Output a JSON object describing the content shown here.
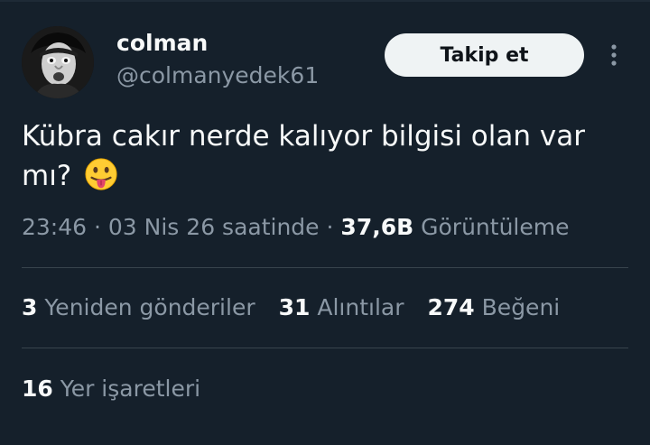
{
  "author": {
    "display_name": "colman",
    "handle": "@colmanyedek61",
    "avatar_icon": "profile-photo"
  },
  "follow_button": {
    "label": "Takip et"
  },
  "more_icon": "more-vertical-icon",
  "tweet": {
    "text": "Kübra cakır nerde kalıyor bilgisi olan var mı?",
    "emoji": "face-with-tongue-emoji"
  },
  "meta": {
    "time": "23:46",
    "date": "03 Nis 26 saatinde",
    "separator": "·",
    "views_count": "37,6B",
    "views_label": "Görüntüleme"
  },
  "stats": {
    "retweets": {
      "count": "3",
      "label": "Yeniden gönderiler"
    },
    "quotes": {
      "count": "31",
      "label": "Alıntılar"
    },
    "likes": {
      "count": "274",
      "label": "Beğeni"
    },
    "bookmarks": {
      "count": "16",
      "label": "Yer işaretleri"
    }
  },
  "colors": {
    "background": "#15202b",
    "text_primary": "#f7f9f9",
    "text_secondary": "#8b98a5",
    "divider": "#38444d",
    "follow_button_bg": "#eff3f4"
  }
}
